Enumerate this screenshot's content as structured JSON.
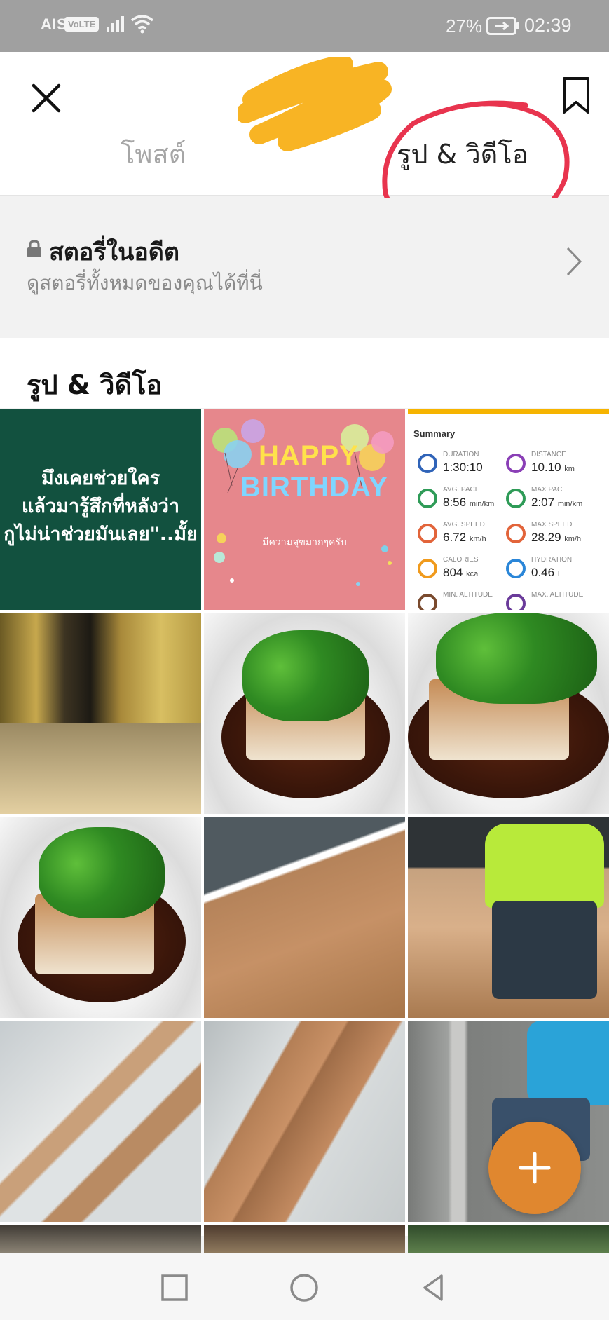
{
  "status_bar": {
    "carrier": "AIS",
    "volte": "VoLTE",
    "battery_percent": "27%",
    "time": "02:39"
  },
  "header": {
    "tabs": [
      {
        "label": "โพสต์",
        "active": false
      },
      {
        "label": "รูป & วิดีโอ",
        "active": true
      }
    ],
    "annotation_color": "#e8344e",
    "redaction_color": "#f8b424"
  },
  "past_stories": {
    "title": "สตอรี่ในอดีต",
    "subtitle": "ดูสตอรี่ทั้งหมดของคุณได้ที่นี่"
  },
  "section": {
    "title": "รูป & วิดีโอ"
  },
  "grid": {
    "quote_post": {
      "lines": [
        "มึงเคยช่วยใคร",
        "แล้วมารู้สึกที่หลังว่า",
        "กูไม่น่าช่วยมันเลย\"..มั้ย"
      ]
    },
    "birthday_post": {
      "happy": "HAPPY",
      "birthday": "BIRTHDAY",
      "message": "มีความสุขมากๆครับ"
    },
    "summary_post": {
      "title": "Summary",
      "items": [
        {
          "label": "DURATION",
          "value": "1:30:10",
          "unit": "",
          "icon": "stopwatch-icon",
          "color": "#2f63b8"
        },
        {
          "label": "DISTANCE",
          "value": "10.10",
          "unit": "km",
          "icon": "location-icon",
          "color": "#8a3fb6"
        },
        {
          "label": "AVG. PACE",
          "value": "8:56",
          "unit": "min/km",
          "icon": "gauge-icon",
          "color": "#2e9b57"
        },
        {
          "label": "MAX PACE",
          "value": "2:07",
          "unit": "min/km",
          "icon": "gauge-icon",
          "color": "#2e9b57"
        },
        {
          "label": "AVG. SPEED",
          "value": "6.72",
          "unit": "km/h",
          "icon": "speed-icon",
          "color": "#e2643a"
        },
        {
          "label": "MAX SPEED",
          "value": "28.29",
          "unit": "km/h",
          "icon": "speed-icon",
          "color": "#e2643a"
        },
        {
          "label": "CALORIES",
          "value": "804",
          "unit": "kcal",
          "icon": "flame-icon",
          "color": "#f09a1c"
        },
        {
          "label": "HYDRATION",
          "value": "0.46",
          "unit": "L",
          "icon": "drops-icon",
          "color": "#2a86d8"
        },
        {
          "label": "MIN. ALTITUDE",
          "value": "",
          "unit": "",
          "icon": "mountain-icon",
          "color": "#7a4a2e"
        },
        {
          "label": "MAX. ALTITUDE",
          "value": "",
          "unit": "",
          "icon": "mountain-icon",
          "color": "#6a3b9a"
        }
      ]
    },
    "photos": [
      "hallway-photo",
      "tofu-photo",
      "tofu-photo",
      "tofu-photo",
      "floor-photo",
      "worker-photo",
      "planks-photo",
      "planks-photo",
      "tiler-photo",
      "partial-photo",
      "partial-photo",
      "partial-photo"
    ]
  },
  "fab": {
    "icon": "plus-icon",
    "color": "#e0872f"
  },
  "nav_bar": {
    "icons": [
      "recent-apps-icon",
      "home-icon",
      "back-icon"
    ]
  }
}
